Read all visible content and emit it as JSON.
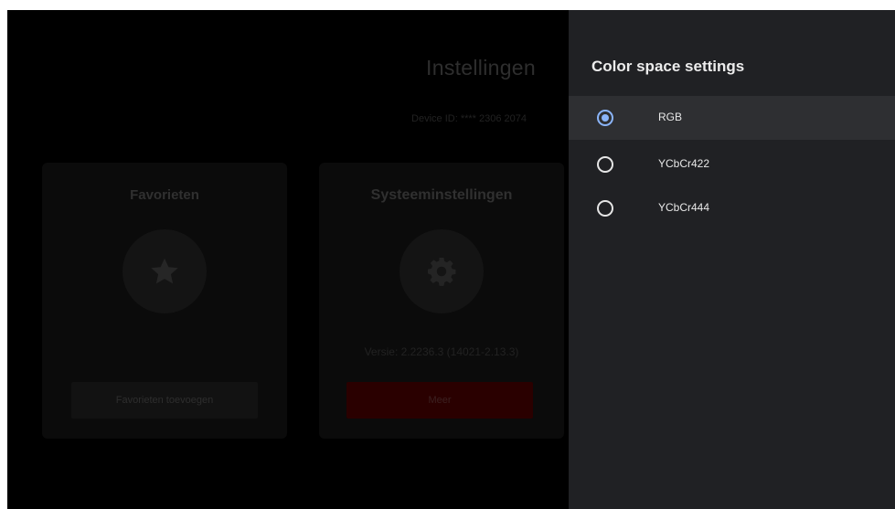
{
  "background_app": {
    "title": "Instellingen",
    "device_id": "Device ID: **** 2306 2074",
    "favorites_card": {
      "title": "Favorieten",
      "icon": "star-icon",
      "button_label": "Favorieten toevoegen"
    },
    "system_card": {
      "title": "Systeeminstellingen",
      "icon": "gear-icon",
      "version": "Versie: 2.2236.3 (14021-2.13.3)",
      "button_label": "Meer"
    }
  },
  "panel": {
    "title": "Color space settings",
    "options": [
      {
        "label": "RGB",
        "selected": true
      },
      {
        "label": "YCbCr422",
        "selected": false
      },
      {
        "label": "YCbCr444",
        "selected": false
      }
    ]
  },
  "colors": {
    "accent": "#8ab4f8",
    "panel_background": "#202124",
    "selected_row": "#2e2f32",
    "brand_button": "#2a0000"
  }
}
